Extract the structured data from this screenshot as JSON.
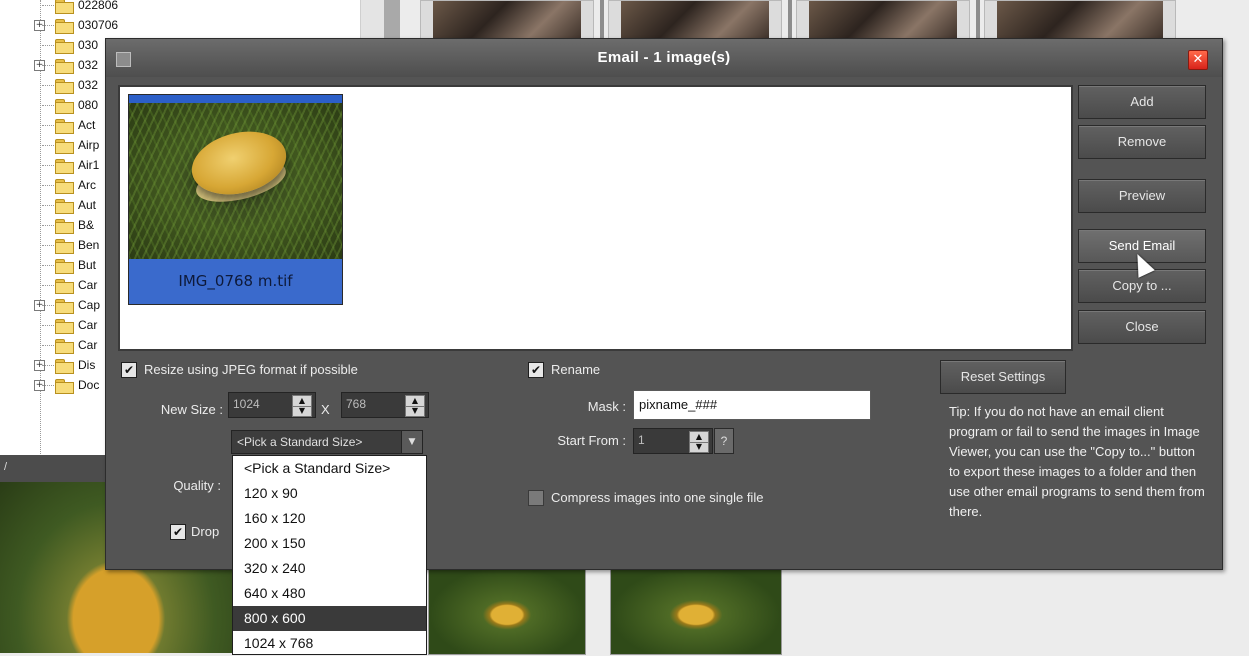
{
  "tree": {
    "items": [
      {
        "label": "022806",
        "expandable": false
      },
      {
        "label": "030706",
        "expandable": true
      },
      {
        "label": "030",
        "expandable": false
      },
      {
        "label": "032",
        "expandable": true
      },
      {
        "label": "032",
        "expandable": false
      },
      {
        "label": "080",
        "expandable": false
      },
      {
        "label": "Act",
        "expandable": false
      },
      {
        "label": "Airp",
        "expandable": false
      },
      {
        "label": "Air1",
        "expandable": false
      },
      {
        "label": "Arc",
        "expandable": false
      },
      {
        "label": "Aut",
        "expandable": false
      },
      {
        "label": "B&",
        "expandable": false
      },
      {
        "label": "Ben",
        "expandable": false
      },
      {
        "label": "But",
        "expandable": false
      },
      {
        "label": "Car",
        "expandable": false
      },
      {
        "label": "Cap",
        "expandable": true
      },
      {
        "label": "Car",
        "expandable": false
      },
      {
        "label": "Car",
        "expandable": false
      },
      {
        "label": "Dis",
        "expandable": true
      },
      {
        "label": "Doc",
        "expandable": true
      }
    ]
  },
  "view_bar": {
    "label": "/"
  },
  "dialog": {
    "title": "Email  - 1 image(s)",
    "close_glyph": "✕",
    "image": {
      "caption": "IMG_0768 m.tif"
    },
    "buttons": {
      "add": "Add",
      "remove": "Remove",
      "preview": "Preview",
      "send_email": "Send Email",
      "copy_to": "Copy to ...",
      "close": "Close",
      "reset": "Reset Settings"
    },
    "resize": {
      "checkbox_label": "Resize using JPEG format if possible",
      "checked": true,
      "new_size_label": "New Size :",
      "width": "1024",
      "x_label": "X",
      "height": "768",
      "standard_size_selected": "<Pick a Standard Size>"
    },
    "quality_label": "Quality :",
    "drop_label": "Drop",
    "rename": {
      "checkbox_label": "Rename",
      "checked": true,
      "mask_label": "Mask :",
      "mask_value": "pixname_###",
      "start_from_label": "Start From :",
      "start_from_value": "1",
      "help": "?"
    },
    "compress": {
      "checkbox_label": "Compress images into one single file",
      "checked": false
    },
    "tip": "Tip: If you do not have an email client program or fail to send the images in Image Viewer, you can use the \"Copy to...\" button to export these images to a folder and then use other email programs to send them from there."
  },
  "dropdown": {
    "options": [
      "<Pick a Standard Size>",
      "120 x 90",
      "160 x 120",
      "200 x 150",
      "320 x 240",
      "640 x 480",
      "800 x 600",
      "1024 x 768"
    ],
    "highlighted": "800 x 600"
  },
  "icons": {
    "checkbox": "check-icon",
    "spinner": "spinner-arrows-icon",
    "combo": "chevron-down-icon",
    "close": "close-icon",
    "folder": "folder-icon"
  },
  "colors": {
    "dialog_bg": "#545454",
    "selection_blue": "#3a6acc",
    "close_red": "#d8231a"
  }
}
